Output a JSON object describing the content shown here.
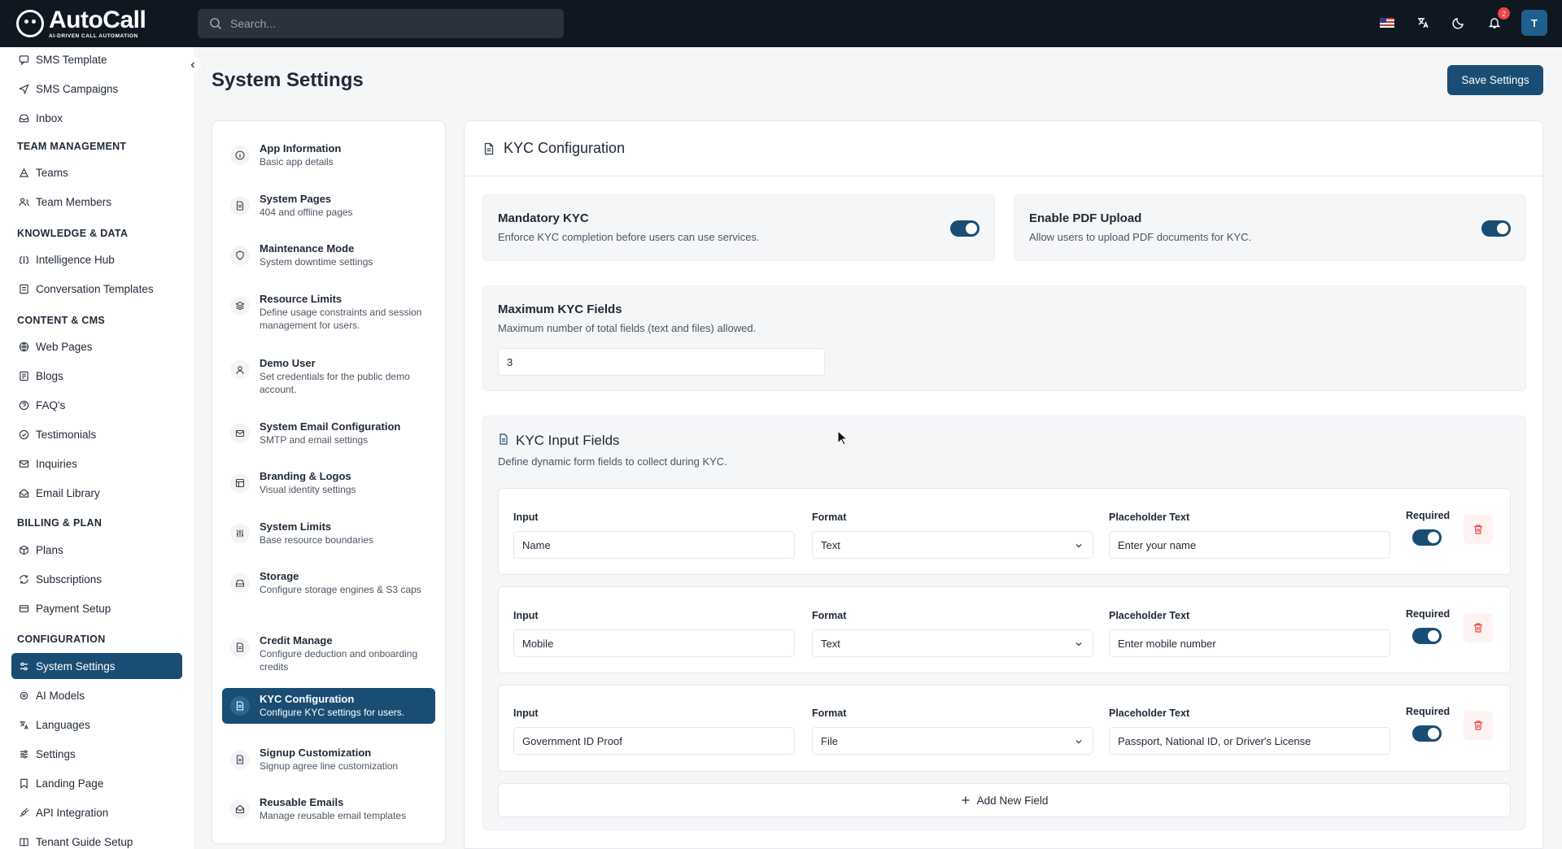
{
  "app": {
    "logo_title": "AutoCall",
    "logo_subtitle": "AI-DRIVEN CALL AUTOMATION",
    "notification_count": "2",
    "avatar_initial": "T"
  },
  "search": {
    "placeholder": "Search..."
  },
  "sidebar": {
    "items_top": [
      {
        "label": "SMS Template",
        "icon": "sms-template-icon"
      },
      {
        "label": "SMS Campaigns",
        "icon": "send-icon"
      },
      {
        "label": "Inbox",
        "icon": "inbox-icon"
      }
    ],
    "sections": [
      {
        "title": "TEAM MANAGEMENT",
        "items": [
          {
            "label": "Teams"
          },
          {
            "label": "Team Members"
          }
        ]
      },
      {
        "title": "KNOWLEDGE & DATA",
        "items": [
          {
            "label": "Intelligence Hub"
          },
          {
            "label": "Conversation Templates"
          }
        ]
      },
      {
        "title": "CONTENT & CMS",
        "items": [
          {
            "label": "Web Pages"
          },
          {
            "label": "Blogs"
          },
          {
            "label": "FAQ's"
          },
          {
            "label": "Testimonials"
          },
          {
            "label": "Inquiries"
          },
          {
            "label": "Email Library"
          }
        ]
      },
      {
        "title": "BILLING & PLAN",
        "items": [
          {
            "label": "Plans"
          },
          {
            "label": "Subscriptions"
          },
          {
            "label": "Payment Setup"
          }
        ]
      },
      {
        "title": "CONFIGURATION",
        "items": [
          {
            "label": "System Settings"
          },
          {
            "label": "AI Models"
          },
          {
            "label": "Languages"
          },
          {
            "label": "Settings"
          },
          {
            "label": "Landing Page"
          },
          {
            "label": "API Integration"
          },
          {
            "label": "Tenant Guide Setup"
          }
        ]
      }
    ],
    "active": "System Settings"
  },
  "page": {
    "title": "System Settings",
    "save_label": "Save Settings"
  },
  "settings_menu": [
    {
      "title": "App Information",
      "sub": "Basic app details"
    },
    {
      "title": "System Pages",
      "sub": "404 and offline pages"
    },
    {
      "title": "Maintenance Mode",
      "sub": "System downtime settings"
    },
    {
      "title": "Resource Limits",
      "sub": "Define usage constraints and session management for users."
    },
    {
      "title": "Demo User",
      "sub": "Set credentials for the public demo account."
    },
    {
      "title": "System Email Configuration",
      "sub": "SMTP and email settings"
    },
    {
      "title": "Branding & Logos",
      "sub": "Visual identity settings"
    },
    {
      "title": "System Limits",
      "sub": "Base resource boundaries"
    },
    {
      "title": "Storage",
      "sub": "Configure storage engines & S3 caps"
    },
    {
      "title": "Credit Manage",
      "sub": "Configure deduction and onboarding credits"
    },
    {
      "title": "KYC Configuration",
      "sub": "Configure KYC settings for users."
    },
    {
      "title": "Signup Customization",
      "sub": "Signup agree line customization"
    },
    {
      "title": "Reusable Emails",
      "sub": "Manage reusable email templates"
    }
  ],
  "kyc": {
    "title": "KYC Configuration",
    "mandatory": {
      "title": "Mandatory KYC",
      "desc": "Enforce KYC completion before users can use services.",
      "enabled": true
    },
    "pdf": {
      "title": "Enable PDF Upload",
      "desc": "Allow users to upload PDF documents for KYC.",
      "enabled": true
    },
    "max_fields": {
      "title": "Maximum KYC Fields",
      "desc": "Maximum number of total fields (text and files) allowed.",
      "value": "3"
    },
    "input_fields": {
      "title": "KYC Input Fields",
      "desc": "Define dynamic form fields to collect during KYC.",
      "labels": {
        "input": "Input",
        "format": "Format",
        "placeholder": "Placeholder Text",
        "required": "Required"
      },
      "rows": [
        {
          "input": "Name",
          "format": "Text",
          "placeholder": "Enter your name",
          "required": true
        },
        {
          "input": "Mobile",
          "format": "Text",
          "placeholder": "Enter mobile number",
          "required": true
        },
        {
          "input": "Government ID Proof",
          "format": "File",
          "placeholder": "Passport, National ID, or Driver's License",
          "required": true
        }
      ],
      "add_label": "Add New Field"
    }
  },
  "colors": {
    "accent": "#1a4d73",
    "topbar": "#0f1720",
    "danger": "#ef4444"
  }
}
